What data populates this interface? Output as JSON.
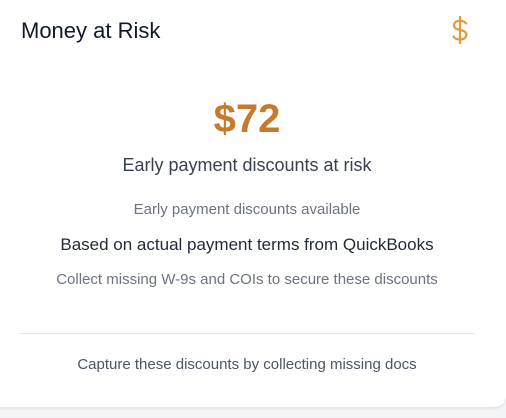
{
  "card": {
    "title": "Money at Risk",
    "icon": "dollar-icon",
    "accent_color": "#c87a2c"
  },
  "summary": {
    "amount": "$72",
    "label": "Early payment discounts at risk",
    "available_note": "Early payment discounts available",
    "source_note": "Based on actual payment terms from QuickBooks",
    "action_note": "Collect missing W-9s and COIs to secure these discounts"
  },
  "footer": {
    "text": "Capture these discounts by collecting missing docs"
  }
}
